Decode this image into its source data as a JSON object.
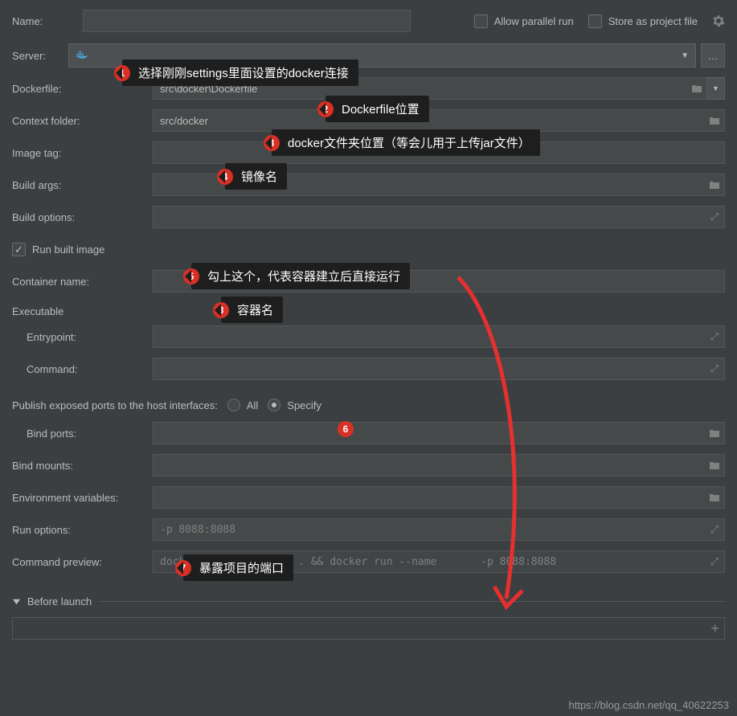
{
  "top": {
    "name_label": "Name:",
    "name_value": "",
    "allow_parallel": "Allow parallel run",
    "store_project": "Store as project file"
  },
  "server": {
    "label": "Server:"
  },
  "dockerfile": {
    "label": "Dockerfile:",
    "value": "src\\docker\\Dockerfile"
  },
  "context": {
    "label": "Context folder:",
    "value": "src/docker"
  },
  "imagetag": {
    "label": "Image tag:",
    "value": ""
  },
  "buildargs": {
    "label": "Build args:"
  },
  "buildoptions": {
    "label": "Build options:"
  },
  "runbuilt": {
    "label": "Run built image"
  },
  "container": {
    "label": "Container name:",
    "value": ""
  },
  "executable": {
    "header": "Executable",
    "entrypoint": "Entrypoint:",
    "command": "Command:"
  },
  "publish": {
    "label": "Publish exposed ports to the host interfaces:",
    "all": "All",
    "specify": "Specify"
  },
  "bindports": {
    "label": "Bind ports:"
  },
  "bindmounts": {
    "label": "Bind mounts:"
  },
  "env": {
    "label": "Environment variables:"
  },
  "runoptions": {
    "label": "Run options:",
    "value": "-p 8088:8088"
  },
  "preview": {
    "label": "Command preview:",
    "value": "docker build -t       . && docker run --name       -p 8088:8088"
  },
  "beforelaunch": {
    "label": "Before launch"
  },
  "watermark": "https://blog.csdn.net/qq_40622253",
  "callouts": {
    "c1": {
      "num": "1",
      "text": "选择刚刚settings里面设置的docker连接"
    },
    "c2": {
      "num": "2",
      "text": "Dockerfile位置"
    },
    "c3": {
      "num": "3",
      "text": "docker文件夹位置（等会儿用于上传jar文件）"
    },
    "c4": {
      "num": "4",
      "text": "镜像名"
    },
    "c5": {
      "num": "5",
      "text": "勾上这个，代表容器建立后直接运行"
    },
    "c6": {
      "num": "6"
    },
    "c7": {
      "num": "7",
      "text": "暴露项目的端口"
    },
    "c8": {
      "num": "8",
      "text": "容器名"
    }
  }
}
